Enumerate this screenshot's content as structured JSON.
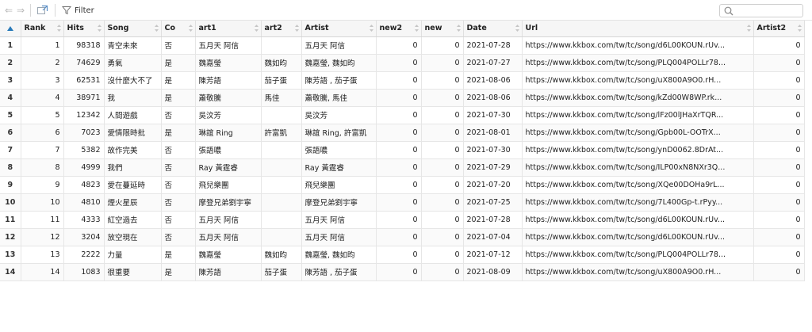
{
  "toolbar": {
    "filter_label": "Filter",
    "search_placeholder": "",
    "accent_color": "#2a7ab9"
  },
  "table": {
    "columns": [
      "Rank",
      "Hits",
      "Song",
      "Co",
      "art1",
      "art2",
      "Artist",
      "new2",
      "new",
      "Date",
      "Url",
      "Artist2"
    ],
    "rows": [
      {
        "row": "1",
        "Rank": "1",
        "Hits": "98318",
        "Song": "青空未來",
        "Co": "否",
        "art1": "五月天 阿信",
        "art2": "",
        "Artist": "五月天 阿信",
        "new2": "0",
        "new": "0",
        "Date": "2021-07-28",
        "Url": "https://www.kkbox.com/tw/tc/song/d6L00KOUN.rUv...",
        "Artist2": "0"
      },
      {
        "row": "2",
        "Rank": "2",
        "Hits": "74629",
        "Song": "勇氣",
        "Co": "是",
        "art1": "魏嘉瑩",
        "art2": "魏如昀",
        "Artist": "魏嘉瑩, 魏如昀",
        "new2": "0",
        "new": "0",
        "Date": "2021-07-27",
        "Url": "https://www.kkbox.com/tw/tc/song/PLQ004POLLr78...",
        "Artist2": "0"
      },
      {
        "row": "3",
        "Rank": "3",
        "Hits": "62531",
        "Song": "沒什麼大不了",
        "Co": "是",
        "art1": "陳芳語",
        "art2": "茄子蛋",
        "Artist": "陳芳語 , 茄子蛋",
        "new2": "0",
        "new": "0",
        "Date": "2021-08-06",
        "Url": "https://www.kkbox.com/tw/tc/song/uX800A9O0.rH...",
        "Artist2": "0"
      },
      {
        "row": "4",
        "Rank": "4",
        "Hits": "38971",
        "Song": "我",
        "Co": "是",
        "art1": "蕭敬騰",
        "art2": "馬佳",
        "Artist": "蕭敬騰, 馬佳",
        "new2": "0",
        "new": "0",
        "Date": "2021-08-06",
        "Url": "https://www.kkbox.com/tw/tc/song/kZd00W8WP.rk...",
        "Artist2": "0"
      },
      {
        "row": "5",
        "Rank": "5",
        "Hits": "12342",
        "Song": "人間遊戲",
        "Co": "否",
        "art1": "吳汶芳",
        "art2": "",
        "Artist": "吳汶芳",
        "new2": "0",
        "new": "0",
        "Date": "2021-07-30",
        "Url": "https://www.kkbox.com/tw/tc/song/lFz00lJHaXrTQR...",
        "Artist2": "0"
      },
      {
        "row": "6",
        "Rank": "6",
        "Hits": "7023",
        "Song": "愛情限時批",
        "Co": "是",
        "art1": "琳誼 Ring",
        "art2": "許富凱",
        "Artist": "琳誼 Ring, 許富凱",
        "new2": "0",
        "new": "0",
        "Date": "2021-08-01",
        "Url": "https://www.kkbox.com/tw/tc/song/Gpb00L-OOTrX...",
        "Artist2": "0"
      },
      {
        "row": "7",
        "Rank": "7",
        "Hits": "5382",
        "Song": "故作完美",
        "Co": "否",
        "art1": "張語噥",
        "art2": "",
        "Artist": "張語噥",
        "new2": "0",
        "new": "0",
        "Date": "2021-07-30",
        "Url": "https://www.kkbox.com/tw/tc/song/ynD0062.8DrAt...",
        "Artist2": "0"
      },
      {
        "row": "8",
        "Rank": "8",
        "Hits": "4999",
        "Song": "我們",
        "Co": "否",
        "art1": "Ray 黃霆睿",
        "art2": "",
        "Artist": "Ray 黃霆睿",
        "new2": "0",
        "new": "0",
        "Date": "2021-07-29",
        "Url": "https://www.kkbox.com/tw/tc/song/ILP00xN8NXr3Q...",
        "Artist2": "0"
      },
      {
        "row": "9",
        "Rank": "9",
        "Hits": "4823",
        "Song": "愛在蔓延時",
        "Co": "否",
        "art1": "飛兒樂團",
        "art2": "",
        "Artist": "飛兒樂團",
        "new2": "0",
        "new": "0",
        "Date": "2021-07-20",
        "Url": "https://www.kkbox.com/tw/tc/song/XQe00DOHa9rL...",
        "Artist2": "0"
      },
      {
        "row": "10",
        "Rank": "10",
        "Hits": "4810",
        "Song": "煙火星辰",
        "Co": "否",
        "art1": "摩登兄弟劉宇寧",
        "art2": "",
        "Artist": "摩登兄弟劉宇寧",
        "new2": "0",
        "new": "0",
        "Date": "2021-07-25",
        "Url": "https://www.kkbox.com/tw/tc/song/7L400Gp-t.rPyy...",
        "Artist2": "0"
      },
      {
        "row": "11",
        "Rank": "11",
        "Hits": "4333",
        "Song": "紅空過去",
        "Co": "否",
        "art1": "五月天 阿信",
        "art2": "",
        "Artist": "五月天 阿信",
        "new2": "0",
        "new": "0",
        "Date": "2021-07-28",
        "Url": "https://www.kkbox.com/tw/tc/song/d6L00KOUN.rUv...",
        "Artist2": "0"
      },
      {
        "row": "12",
        "Rank": "12",
        "Hits": "3204",
        "Song": "放空現在",
        "Co": "否",
        "art1": "五月天 阿信",
        "art2": "",
        "Artist": "五月天 阿信",
        "new2": "0",
        "new": "0",
        "Date": "2021-07-04",
        "Url": "https://www.kkbox.com/tw/tc/song/d6L00KOUN.rUv...",
        "Artist2": "0"
      },
      {
        "row": "13",
        "Rank": "13",
        "Hits": "2222",
        "Song": "力量",
        "Co": "是",
        "art1": "魏嘉瑩",
        "art2": "魏如昀",
        "Artist": "魏嘉瑩, 魏如昀",
        "new2": "0",
        "new": "0",
        "Date": "2021-07-12",
        "Url": "https://www.kkbox.com/tw/tc/song/PLQ004POLLr78...",
        "Artist2": "0"
      },
      {
        "row": "14",
        "Rank": "14",
        "Hits": "1083",
        "Song": "很重要",
        "Co": "是",
        "art1": "陳芳語",
        "art2": "茄子蛋",
        "Artist": "陳芳語 , 茄子蛋",
        "new2": "0",
        "new": "0",
        "Date": "2021-08-09",
        "Url": "https://www.kkbox.com/tw/tc/song/uX800A9O0.rH...",
        "Artist2": "0"
      }
    ]
  },
  "icons": {
    "back": "back-arrow-icon",
    "forward": "forward-arrow-icon",
    "popout": "popout-window-icon",
    "filter": "funnel-filter-icon",
    "search": "search-icon",
    "sort": "sort-arrows-icon"
  }
}
